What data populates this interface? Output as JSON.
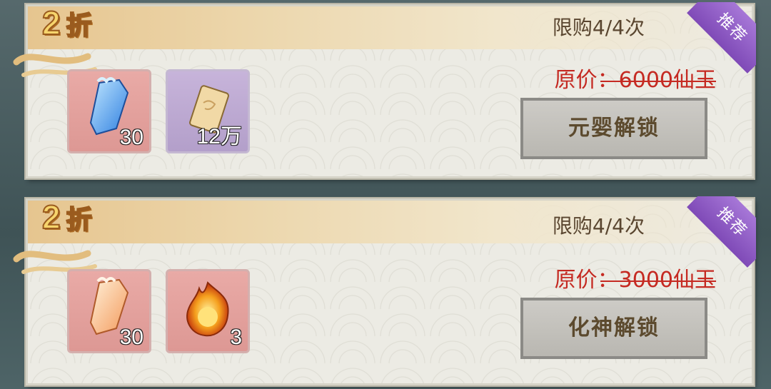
{
  "offers": [
    {
      "discount_number": "2",
      "discount_unit": "折",
      "limit_text": "限购4/4次",
      "badge": "推荐",
      "price_label": "原价：",
      "price_value": "6000仙玉",
      "button_label": "元婴解锁",
      "items": [
        {
          "icon": "blue-spirit-talisman-icon",
          "count": "30",
          "bg": "red"
        },
        {
          "icon": "golden-scroll-card-icon",
          "count": "12万",
          "bg": "purple"
        }
      ]
    },
    {
      "discount_number": "2",
      "discount_unit": "折",
      "limit_text": "限购4/4次",
      "badge": "推荐",
      "price_label": "原价：",
      "price_value": "3000仙玉",
      "button_label": "化神解锁",
      "items": [
        {
          "icon": "orange-spirit-talisman-icon",
          "count": "30",
          "bg": "red"
        },
        {
          "icon": "fire-orb-icon",
          "count": "3",
          "bg": "red"
        }
      ]
    }
  ],
  "colors": {
    "discount_gold": "#f6d46c",
    "price_red": "#c52a22",
    "badge_purple": "#8f5cc6"
  }
}
